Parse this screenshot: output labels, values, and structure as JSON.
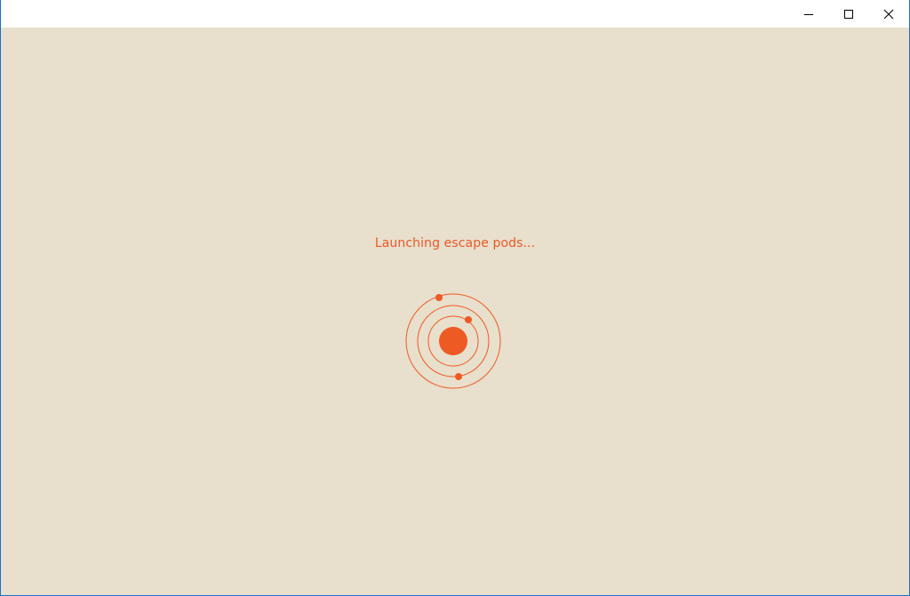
{
  "window": {
    "controls": {
      "minimize_icon": "minimize-icon",
      "maximize_icon": "maximize-icon",
      "close_icon": "close-icon"
    }
  },
  "loading": {
    "message": "Launching escape pods...",
    "spinner_icon": "orbit-loader-icon"
  },
  "colors": {
    "background": "#e8dfcc",
    "accent": "#ee5a24",
    "titlebar": "#ffffff",
    "window_border": "#1a73c9"
  }
}
